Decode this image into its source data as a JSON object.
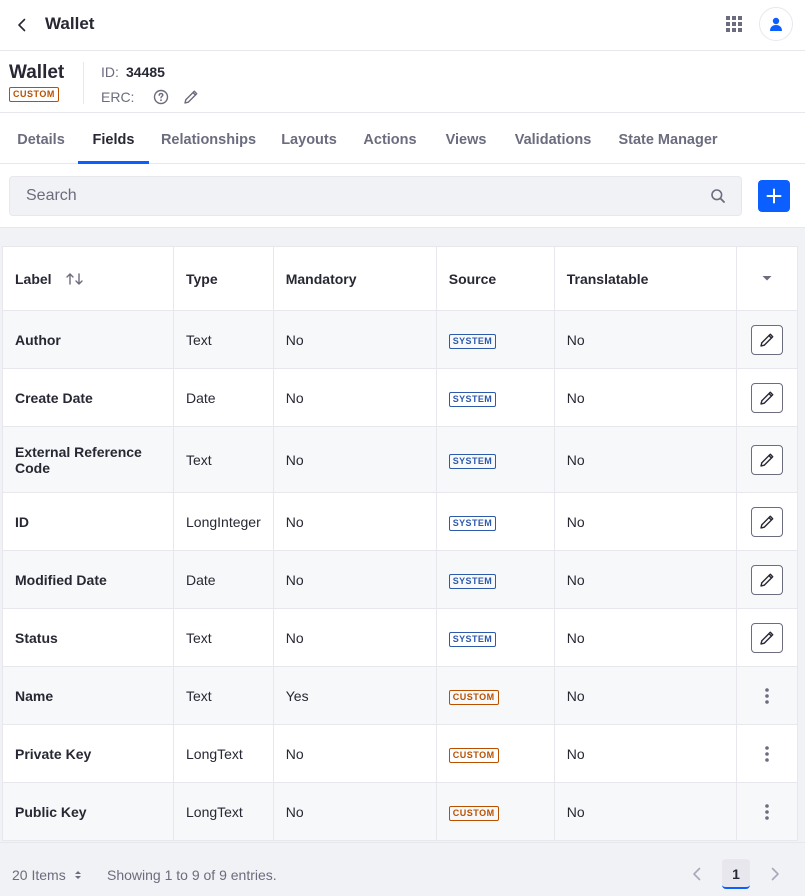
{
  "topbar": {
    "title": "Wallet",
    "back_icon": "chevron-left-icon",
    "apps_icon": "grid-icon",
    "user_icon": "user-icon"
  },
  "header": {
    "name": "Wallet",
    "badge": "CUSTOM",
    "id_label": "ID:",
    "id_value": "34485",
    "erc_label": "ERC:"
  },
  "tabs": [
    {
      "label": "Details",
      "active": false
    },
    {
      "label": "Fields",
      "active": true
    },
    {
      "label": "Relationships",
      "active": false
    },
    {
      "label": "Layouts",
      "active": false
    },
    {
      "label": "Actions",
      "active": false
    },
    {
      "label": "Views",
      "active": false
    },
    {
      "label": "Validations",
      "active": false
    },
    {
      "label": "State Manager",
      "active": false
    }
  ],
  "search": {
    "placeholder": "Search",
    "value": ""
  },
  "table": {
    "columns": [
      "Label",
      "Type",
      "Mandatory",
      "Source",
      "Translatable"
    ],
    "rows": [
      {
        "label": "Author",
        "type": "Text",
        "mandatory": "No",
        "source": "SYSTEM",
        "translatable": "No",
        "action": "edit"
      },
      {
        "label": "Create Date",
        "type": "Date",
        "mandatory": "No",
        "source": "SYSTEM",
        "translatable": "No",
        "action": "edit"
      },
      {
        "label": "External Reference Code",
        "type": "Text",
        "mandatory": "No",
        "source": "SYSTEM",
        "translatable": "No",
        "action": "edit"
      },
      {
        "label": "ID",
        "type": "LongInteger",
        "mandatory": "No",
        "source": "SYSTEM",
        "translatable": "No",
        "action": "edit"
      },
      {
        "label": "Modified Date",
        "type": "Date",
        "mandatory": "No",
        "source": "SYSTEM",
        "translatable": "No",
        "action": "edit"
      },
      {
        "label": "Status",
        "type": "Text",
        "mandatory": "No",
        "source": "SYSTEM",
        "translatable": "No",
        "action": "edit"
      },
      {
        "label": "Name",
        "type": "Text",
        "mandatory": "Yes",
        "source": "CUSTOM",
        "translatable": "No",
        "action": "menu"
      },
      {
        "label": "Private Key",
        "type": "LongText",
        "mandatory": "No",
        "source": "CUSTOM",
        "translatable": "No",
        "action": "menu"
      },
      {
        "label": "Public Key",
        "type": "LongText",
        "mandatory": "No",
        "source": "CUSTOM",
        "translatable": "No",
        "action": "menu"
      }
    ]
  },
  "footer": {
    "items_per_page": "20 Items",
    "showing": "Showing 1 to 9 of 9 entries.",
    "current_page": "1"
  },
  "colors": {
    "accent": "#0b5fff",
    "custom_badge": "#b95000",
    "system_badge": "#2e5aac"
  }
}
